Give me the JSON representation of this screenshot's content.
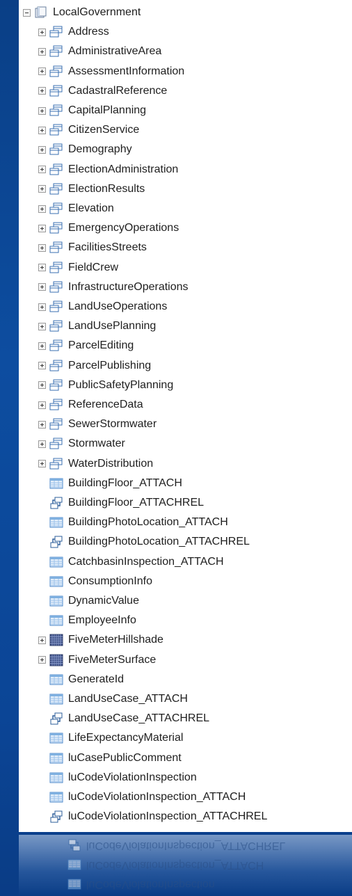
{
  "tree": {
    "root": {
      "label": "LocalGovernment",
      "icon": "geodatabase-icon",
      "expanded": true
    },
    "datasets": [
      "Address",
      "AdministrativeArea",
      "AssessmentInformation",
      "CadastralReference",
      "CapitalPlanning",
      "CitizenService",
      "Demography",
      "ElectionAdministration",
      "ElectionResults",
      "Elevation",
      "EmergencyOperations",
      "FacilitiesStreets",
      "FieldCrew",
      "InfrastructureOperations",
      "LandUseOperations",
      "LandUsePlanning",
      "ParcelEditing",
      "ParcelPublishing",
      "PublicSafetyPlanning",
      "ReferenceData",
      "SewerStormwater",
      "Stormwater",
      "WaterDistribution"
    ],
    "items": [
      {
        "label": "BuildingFloor_ATTACH",
        "icon": "table-icon"
      },
      {
        "label": "BuildingFloor_ATTACHREL",
        "icon": "relationship-class-icon"
      },
      {
        "label": "BuildingPhotoLocation_ATTACH",
        "icon": "table-icon"
      },
      {
        "label": "BuildingPhotoLocation_ATTACHREL",
        "icon": "relationship-class-icon"
      },
      {
        "label": "CatchbasinInspection_ATTACH",
        "icon": "table-icon"
      },
      {
        "label": "ConsumptionInfo",
        "icon": "table-icon"
      },
      {
        "label": "DynamicValue",
        "icon": "table-icon"
      },
      {
        "label": "EmployeeInfo",
        "icon": "table-icon"
      },
      {
        "label": "FiveMeterHillshade",
        "icon": "raster-icon",
        "expandable": true
      },
      {
        "label": "FiveMeterSurface",
        "icon": "raster-icon",
        "expandable": true
      },
      {
        "label": "GenerateId",
        "icon": "table-icon"
      },
      {
        "label": "LandUseCase_ATTACH",
        "icon": "table-icon"
      },
      {
        "label": "LandUseCase_ATTACHREL",
        "icon": "relationship-class-icon"
      },
      {
        "label": "LifeExpectancyMaterial",
        "icon": "table-icon"
      },
      {
        "label": "luCasePublicComment",
        "icon": "table-icon"
      },
      {
        "label": "luCodeViolationInspection",
        "icon": "table-icon"
      },
      {
        "label": "luCodeViolationInspection_ATTACH",
        "icon": "table-icon"
      },
      {
        "label": "luCodeViolationInspection_ATTACHREL",
        "icon": "relationship-class-icon"
      }
    ]
  },
  "colors": {
    "background": "#0d4da0",
    "panel": "#ffffff",
    "text": "#1e1e1e",
    "dataset_icon": "#3a6fb0",
    "table_icon": "#4a86c8"
  }
}
